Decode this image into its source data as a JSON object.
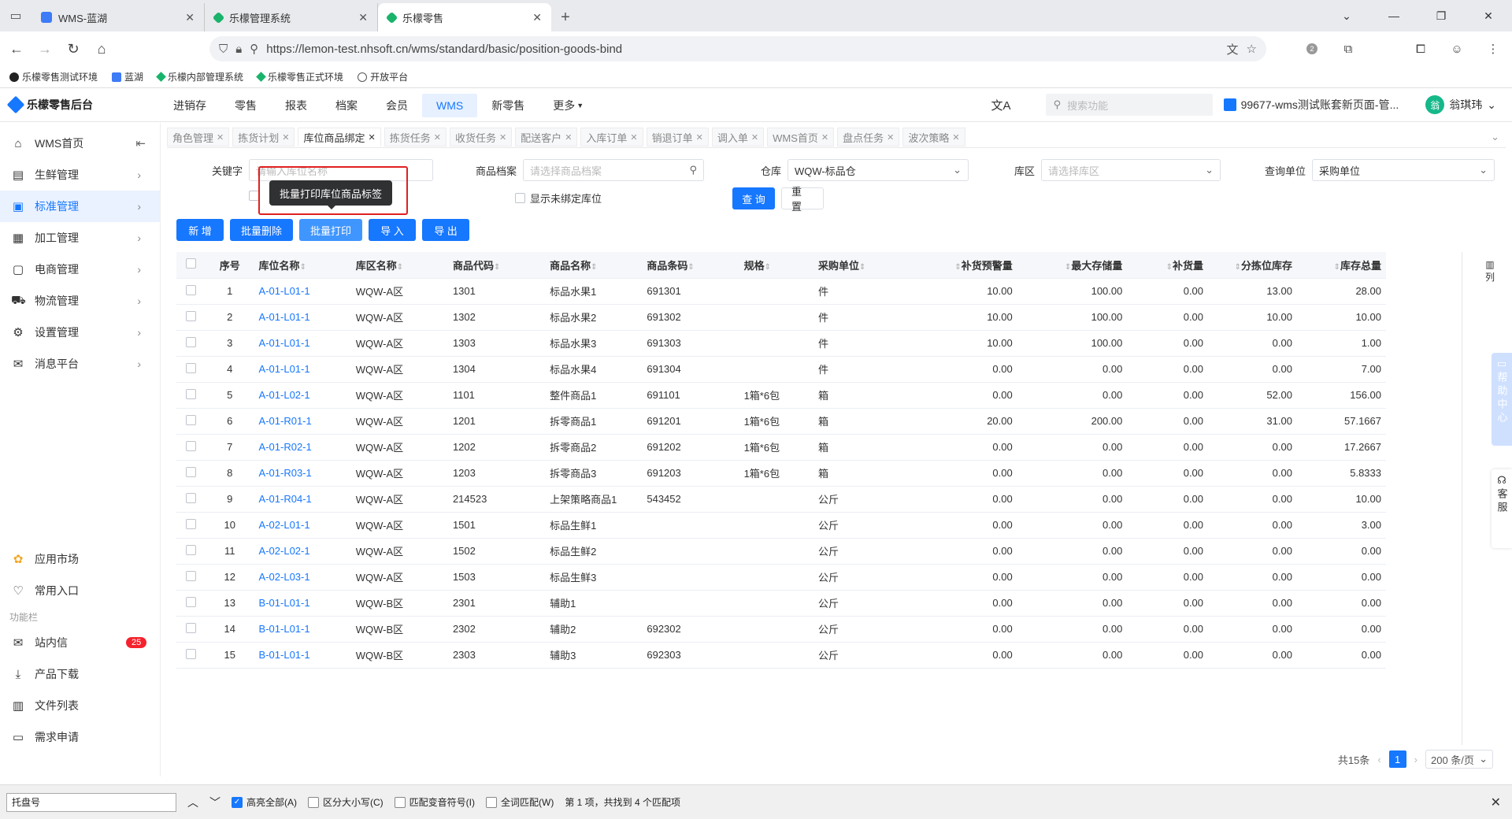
{
  "browser": {
    "tabs": [
      {
        "label": "WMS-蓝湖",
        "color": "#3d7bf7"
      },
      {
        "label": "乐檬管理系统",
        "color": "#19b36b"
      },
      {
        "label": "乐檬零售",
        "color": "#19b36b"
      }
    ],
    "url": "https://lemon-test.nhsoft.cn/wms/standard/basic/position-goods-bind",
    "bookmarks": [
      "乐檬零售测试环境",
      "蓝湖",
      "乐檬内部管理系统",
      "乐檬零售正式环境",
      "开放平台"
    ],
    "ext_badge": "2"
  },
  "app": {
    "title": "乐檬零售后台",
    "nav": [
      "进销存",
      "零售",
      "报表",
      "档案",
      "会员",
      "WMS",
      "新零售",
      "更多"
    ],
    "active_nav": "WMS",
    "search_placeholder": "搜索功能",
    "account": "99677-wms测试账套新页面-管...",
    "user": "翁琪玮",
    "user_initial": "翁"
  },
  "sidebar": {
    "items": [
      {
        "label": "WMS首页",
        "icon": "home-icon"
      },
      {
        "label": "生鲜管理",
        "icon": "fresh-icon"
      },
      {
        "label": "标准管理",
        "icon": "standard-icon"
      },
      {
        "label": "加工管理",
        "icon": "process-icon"
      },
      {
        "label": "电商管理",
        "icon": "ecommerce-icon"
      },
      {
        "label": "物流管理",
        "icon": "truck-icon"
      },
      {
        "label": "设置管理",
        "icon": "gear-icon"
      },
      {
        "label": "消息平台",
        "icon": "message-icon"
      }
    ],
    "bottom": [
      {
        "label": "应用市场"
      },
      {
        "label": "常用入口"
      }
    ],
    "group_title": "功能栏",
    "tools": [
      {
        "label": "站内信",
        "badge": "25"
      },
      {
        "label": "产品下载"
      },
      {
        "label": "文件列表"
      },
      {
        "label": "需求申请"
      }
    ]
  },
  "page_tabs": [
    "角色管理",
    "拣货计划",
    "库位商品绑定",
    "拣货任务",
    "收货任务",
    "配送客户",
    "入库订单",
    "销退订单",
    "调入单",
    "WMS首页",
    "盘点任务",
    "波次策略"
  ],
  "active_page_tab": "库位商品绑定",
  "filters": {
    "keyword_label": "关键字",
    "keyword_placeholder": "请输入库位名称",
    "goods_label": "商品档案",
    "goods_placeholder": "请选择商品档案",
    "warehouse_label": "仓库",
    "warehouse_value": "WQW-标品仓",
    "zone_label": "库区",
    "zone_placeholder": "请选择库区",
    "unit_label": "查询单位",
    "unit_value": "采购单位",
    "show_unbound": "显示未绑定库位",
    "query": "查 询",
    "reset": "重 置"
  },
  "actions": [
    "新 增",
    "批量删除",
    "批量打印",
    "导 入",
    "导 出"
  ],
  "tooltip": "批量打印库位商品标签",
  "table": {
    "headers": [
      "序号",
      "库位名称",
      "库区名称",
      "商品代码",
      "商品名称",
      "商品条码",
      "规格",
      "采购单位",
      "补货预警量",
      "最大存储量",
      "补货量",
      "分拣位库存",
      "库存总量"
    ],
    "rows": [
      [
        "1",
        "A-01-L01-1",
        "WQW-A区",
        "1301",
        "标品水果1",
        "691301",
        "",
        "件",
        "10.00",
        "100.00",
        "0.00",
        "13.00",
        "28.00"
      ],
      [
        "2",
        "A-01-L01-1",
        "WQW-A区",
        "1302",
        "标品水果2",
        "691302",
        "",
        "件",
        "10.00",
        "100.00",
        "0.00",
        "10.00",
        "10.00"
      ],
      [
        "3",
        "A-01-L01-1",
        "WQW-A区",
        "1303",
        "标品水果3",
        "691303",
        "",
        "件",
        "10.00",
        "100.00",
        "0.00",
        "0.00",
        "1.00"
      ],
      [
        "4",
        "A-01-L01-1",
        "WQW-A区",
        "1304",
        "标品水果4",
        "691304",
        "",
        "件",
        "0.00",
        "0.00",
        "0.00",
        "0.00",
        "7.00"
      ],
      [
        "5",
        "A-01-L02-1",
        "WQW-A区",
        "1101",
        "整件商品1",
        "691101",
        "1箱*6包",
        "箱",
        "0.00",
        "0.00",
        "0.00",
        "52.00",
        "156.00"
      ],
      [
        "6",
        "A-01-R01-1",
        "WQW-A区",
        "1201",
        "拆零商品1",
        "691201",
        "1箱*6包",
        "箱",
        "20.00",
        "200.00",
        "0.00",
        "31.00",
        "57.1667"
      ],
      [
        "7",
        "A-01-R02-1",
        "WQW-A区",
        "1202",
        "拆零商品2",
        "691202",
        "1箱*6包",
        "箱",
        "0.00",
        "0.00",
        "0.00",
        "0.00",
        "17.2667"
      ],
      [
        "8",
        "A-01-R03-1",
        "WQW-A区",
        "1203",
        "拆零商品3",
        "691203",
        "1箱*6包",
        "箱",
        "0.00",
        "0.00",
        "0.00",
        "0.00",
        "5.8333"
      ],
      [
        "9",
        "A-01-R04-1",
        "WQW-A区",
        "214523",
        "上架策略商品1",
        "543452",
        "",
        "公斤",
        "0.00",
        "0.00",
        "0.00",
        "0.00",
        "10.00"
      ],
      [
        "10",
        "A-02-L01-1",
        "WQW-A区",
        "1501",
        "标品生鲜1",
        "",
        "",
        "公斤",
        "0.00",
        "0.00",
        "0.00",
        "0.00",
        "3.00"
      ],
      [
        "11",
        "A-02-L02-1",
        "WQW-A区",
        "1502",
        "标品生鲜2",
        "",
        "",
        "公斤",
        "0.00",
        "0.00",
        "0.00",
        "0.00",
        "0.00"
      ],
      [
        "12",
        "A-02-L03-1",
        "WQW-A区",
        "1503",
        "标品生鲜3",
        "",
        "",
        "公斤",
        "0.00",
        "0.00",
        "0.00",
        "0.00",
        "0.00"
      ],
      [
        "13",
        "B-01-L01-1",
        "WQW-B区",
        "2301",
        "辅助1",
        "",
        "",
        "公斤",
        "0.00",
        "0.00",
        "0.00",
        "0.00",
        "0.00"
      ],
      [
        "14",
        "B-01-L01-1",
        "WQW-B区",
        "2302",
        "辅助2",
        "692302",
        "",
        "公斤",
        "0.00",
        "0.00",
        "0.00",
        "0.00",
        "0.00"
      ],
      [
        "15",
        "B-01-L01-1",
        "WQW-B区",
        "2303",
        "辅助3",
        "692303",
        "",
        "公斤",
        "0.00",
        "0.00",
        "0.00",
        "0.00",
        "0.00"
      ]
    ]
  },
  "column_setting": "列",
  "help_center": "帮助中心",
  "customer_service": "客服",
  "pager": {
    "total": "共15条",
    "page": "1",
    "page_size": "200 条/页"
  },
  "findbar": {
    "query": "托盘号",
    "options": [
      {
        "label": "高亮全部(A)",
        "checked": true
      },
      {
        "label": "区分大小写(C)",
        "checked": false
      },
      {
        "label": "匹配变音符号(I)",
        "checked": false
      },
      {
        "label": "全词匹配(W)",
        "checked": false
      }
    ],
    "status": "第 1 项，共找到 4 个匹配项"
  }
}
